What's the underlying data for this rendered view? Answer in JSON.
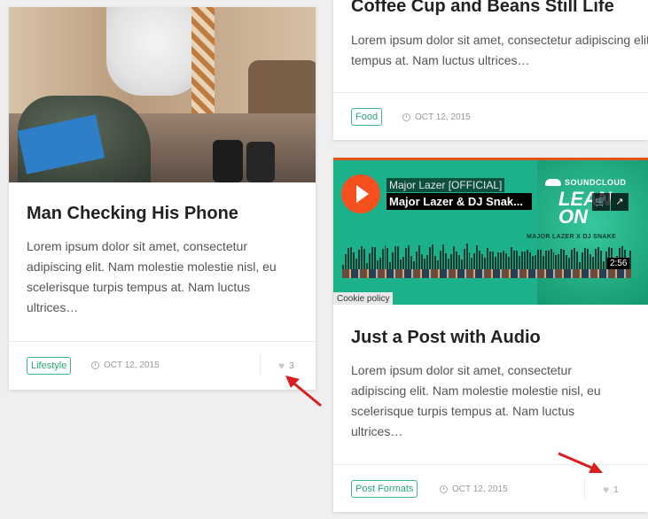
{
  "posts": {
    "left": {
      "title": "Man Checking His Phone",
      "excerpt": "Lorem ipsum dolor sit amet, consectetur adipiscing elit. Nam molestie molestie nisl, eu scelerisque turpis tempus at. Nam luctus ultrices…",
      "tag": "Lifestyle",
      "date": "OCT 12, 2015",
      "likes": "3"
    },
    "right_top": {
      "title": "Coffee Cup and Beans Still Life",
      "excerpt": "Lorem ipsum dolor sit amet, consectetur adipiscing elit tempus at. Nam luctus ultrices…",
      "tag": "Food",
      "date": "OCT 12, 2015"
    },
    "right_bottom": {
      "title": "Just a Post with Audio",
      "excerpt": "Lorem ipsum dolor sit amet, consectetur adipiscing elit. Nam molestie molestie nisl, eu scelerisque turpis tempus at. Nam luctus ultrices…",
      "tag": "Post Formats",
      "date": "OCT 12, 2015",
      "likes": "1"
    }
  },
  "player": {
    "artist": "Major Lazer [OFFICIAL]",
    "track": "Major Lazer & DJ Snak...",
    "brand": "SOUNDCLOUD",
    "art_title_1": "LEAN",
    "art_title_2": "ON",
    "art_credit": "MAJOR LAZER X DJ SNAKE",
    "duration": "2:56",
    "cookie_label": "Cookie policy"
  },
  "colors": {
    "accent_tag": "#3bb583",
    "player_bg": "#1bb18b",
    "play_button": "#f5501e",
    "annotation_arrow": "#d81e1e"
  }
}
